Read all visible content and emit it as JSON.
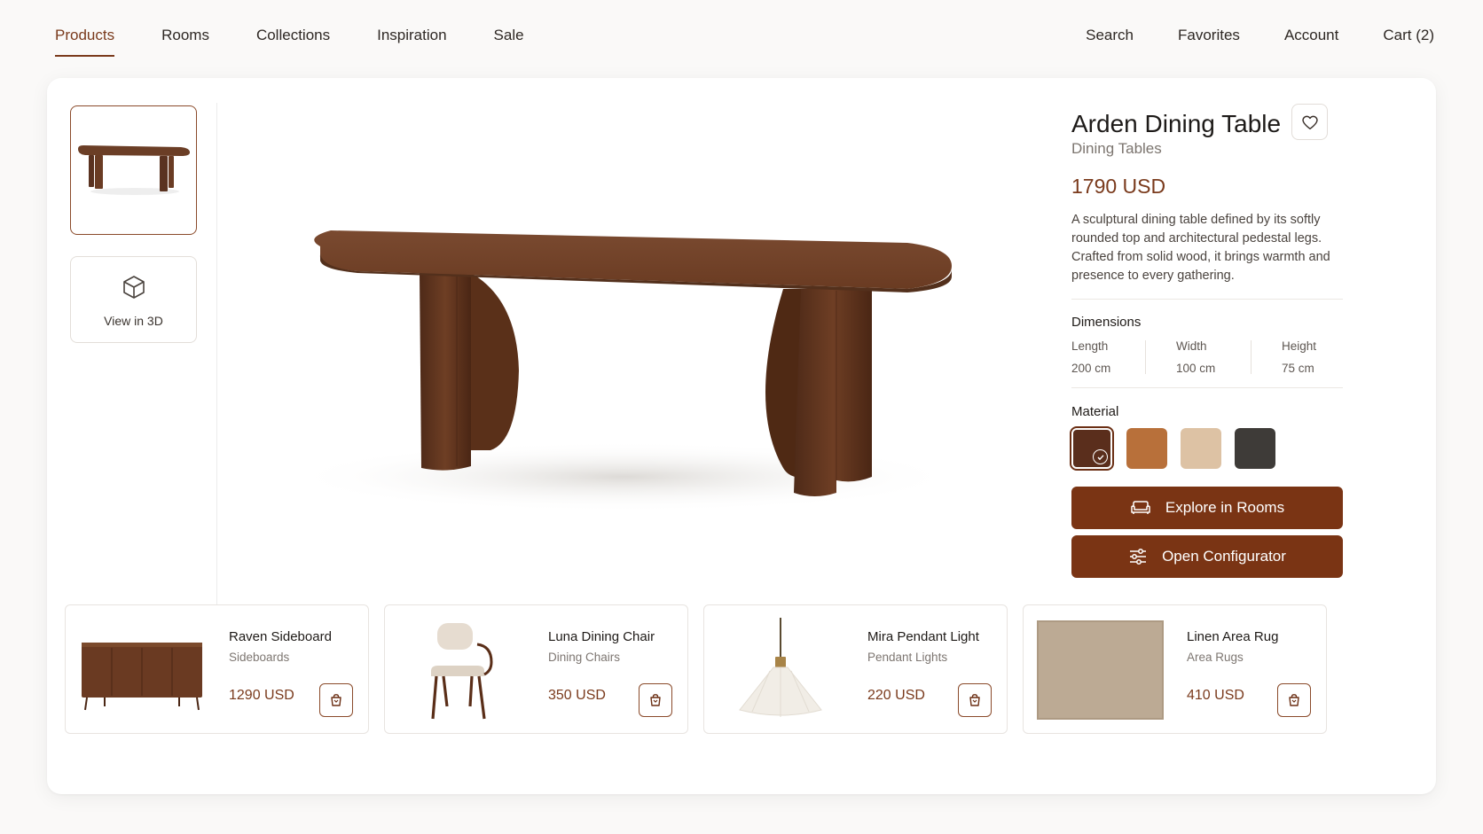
{
  "nav": {
    "left": [
      "Products",
      "Rooms",
      "Collections",
      "Inspiration",
      "Sale"
    ],
    "right": [
      "Search",
      "Favorites",
      "Account",
      "Cart (2)"
    ],
    "active": "Products"
  },
  "gallery": {
    "view3d_label": "View in 3D"
  },
  "product": {
    "title": "Arden Dining Table",
    "category": "Dining Tables",
    "price": "1790 USD",
    "description": "A sculptural dining table defined by its softly rounded top and architectural pedestal legs. Crafted from solid wood, it brings warmth and presence to every gathering.",
    "dimensions_heading": "Dimensions",
    "dimensions": [
      {
        "label": "Length",
        "value": "200 cm"
      },
      {
        "label": "Width",
        "value": "100 cm"
      },
      {
        "label": "Height",
        "value": "75 cm"
      }
    ],
    "material_heading": "Material",
    "materials": [
      {
        "color": "#5a2e1c",
        "selected": true
      },
      {
        "color": "#b8703a",
        "selected": false
      },
      {
        "color": "#ddc2a4",
        "selected": false
      },
      {
        "color": "#3e3b38",
        "selected": false
      }
    ],
    "explore_label": "Explore in Rooms",
    "configurator_label": "Open Configurator"
  },
  "related": [
    {
      "name": "Raven Sideboard",
      "category": "Sideboards",
      "price": "1290 USD",
      "image": "sideboard"
    },
    {
      "name": "Luna Dining Chair",
      "category": "Dining Chairs",
      "price": "350 USD",
      "image": "chair"
    },
    {
      "name": "Mira Pendant Light",
      "category": "Pendant Lights",
      "price": "220 USD",
      "image": "pendant"
    },
    {
      "name": "Linen Area Rug",
      "category": "Area Rugs",
      "price": "410 USD",
      "image": "rug"
    }
  ],
  "colors": {
    "accent": "#7a3414",
    "accent_text": "#7a3a1c"
  }
}
